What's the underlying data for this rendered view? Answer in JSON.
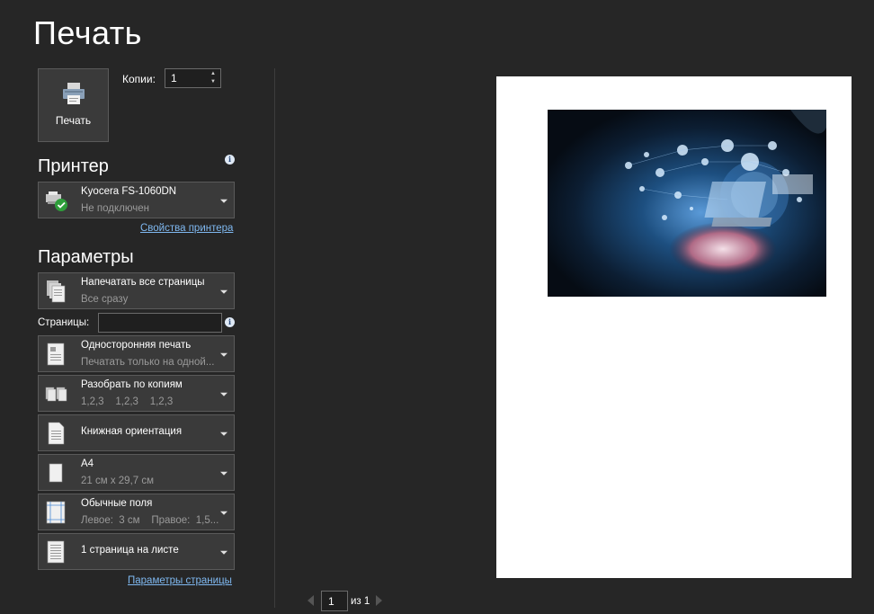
{
  "title": "Печать",
  "print_button": {
    "label": "Печать",
    "icon": "printer-icon"
  },
  "copies": {
    "label": "Копии:",
    "value": "1"
  },
  "printer": {
    "section_title": "Принтер",
    "name": "Kyocera FS-1060DN",
    "status": "Не подключен",
    "properties_link": "Свойства принтера"
  },
  "params": {
    "section_title": "Параметры",
    "pages_label": "Страницы:",
    "pages_value": "",
    "items": [
      {
        "line1": "Напечатать все страницы",
        "line2": "Все сразу",
        "icon": "pages-stack-icon"
      },
      {
        "line1": "Односторонняя печать",
        "line2": "Печатать только на одной...",
        "icon": "one-sided-icon"
      },
      {
        "line1": "Разобрать по копиям",
        "line2": "1,2,3    1,2,3    1,2,3",
        "icon": "collate-icon"
      },
      {
        "line1": "Книжная ориентация",
        "line2": "",
        "icon": "portrait-icon"
      },
      {
        "line1": "A4",
        "line2": "21 см x 29,7 см",
        "icon": "paper-size-icon"
      },
      {
        "line1": "Обычные поля",
        "line2": "Левое:  3 см    Правое:  1,5...",
        "icon": "margins-icon"
      },
      {
        "line1": "1 страница на листе",
        "line2": "",
        "icon": "pages-per-sheet-icon"
      }
    ],
    "page_setup_link": "Параметры страницы"
  },
  "pager": {
    "current": "1",
    "of": "из 1"
  },
  "colors": {
    "background": "#262626",
    "panel": "#3a3a3a",
    "link": "#7fb8f0",
    "accent_green": "#2e9e3a"
  }
}
